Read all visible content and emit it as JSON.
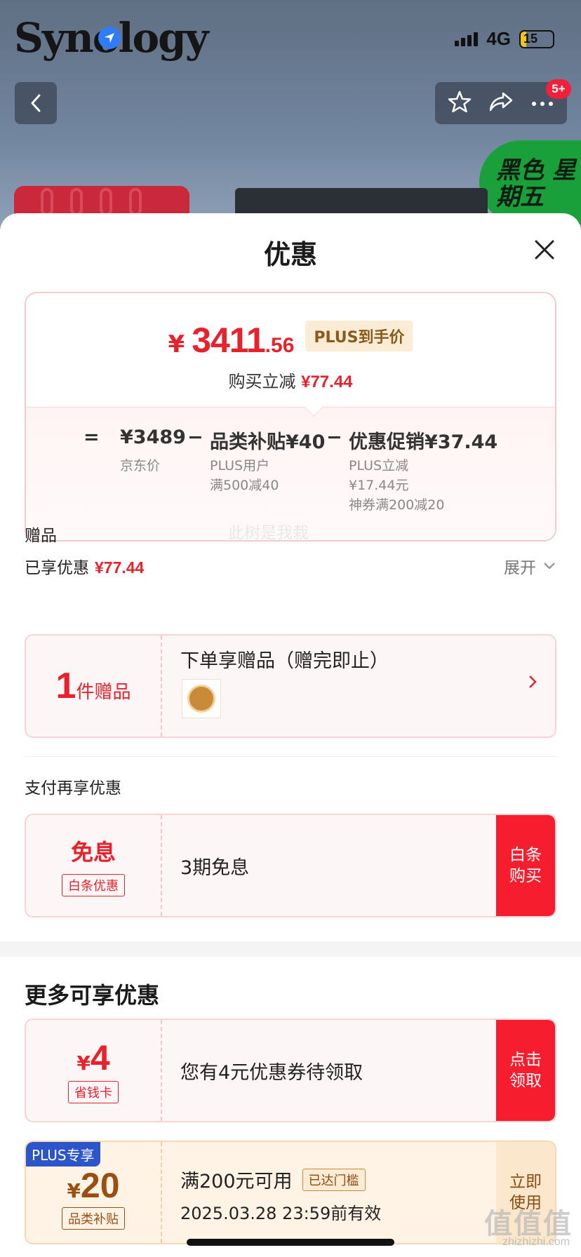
{
  "status_bar": {
    "brand": "Synology",
    "network": "4G",
    "battery": "15"
  },
  "header": {
    "notif_badge": "5+",
    "promo_badge": "黑色 星期五"
  },
  "sheet": {
    "title": "优惠",
    "price": {
      "yen": "¥",
      "integer": "3411",
      "decimal": ".56",
      "plus_tag": "PLUS到手价",
      "saved_label": "购买立减",
      "saved_amount": "¥77.44"
    },
    "breakdown": {
      "eq": "=",
      "jd_price": "¥3489",
      "jd_label": "京东价",
      "minus1": "−",
      "subsidy": "品类补贴¥40",
      "subsidy_sub1": "PLUS用户",
      "subsidy_sub2": "满500减40",
      "minus2": "−",
      "promo": "优惠促销¥37.44",
      "promo_sub1": "PLUS立减",
      "promo_sub2": "¥17.44元",
      "promo_sub3": "神券满200减20"
    },
    "enjoyed_label": "已享优惠",
    "enjoyed_amount": "¥77.44",
    "expand_label": "展开",
    "gift_label": "赠品",
    "watermark": "此树是我栽",
    "gift": {
      "count": "1",
      "count_unit": "件赠品",
      "title": "下单享赠品（赠完即止）"
    },
    "pay_label": "支付再享优惠",
    "baitiao": {
      "title": "免息",
      "tag": "白条优惠",
      "body": "3期免息",
      "action": "白条购买"
    },
    "more_title": "更多可享优惠",
    "card4": {
      "yen": "¥",
      "amount": "4",
      "tag": "省钱卡",
      "body": "您有4元优惠券待领取",
      "action": "点击领取"
    },
    "plus_card": {
      "corner": "PLUS专享",
      "yen": "¥",
      "amount": "20",
      "tag": "品类补贴",
      "line1": "满200元可用",
      "line1_tag": "已达门槛",
      "line2": "2025.03.28 23:59前有效",
      "action": "立即使用"
    }
  },
  "watermark_site": {
    "logo": "值值值",
    "url": "zhizhizhi.com"
  },
  "colors": {
    "accent_red": "#e8222d",
    "action_red": "#f51d2e",
    "plus_blue": "#2b55c9"
  }
}
